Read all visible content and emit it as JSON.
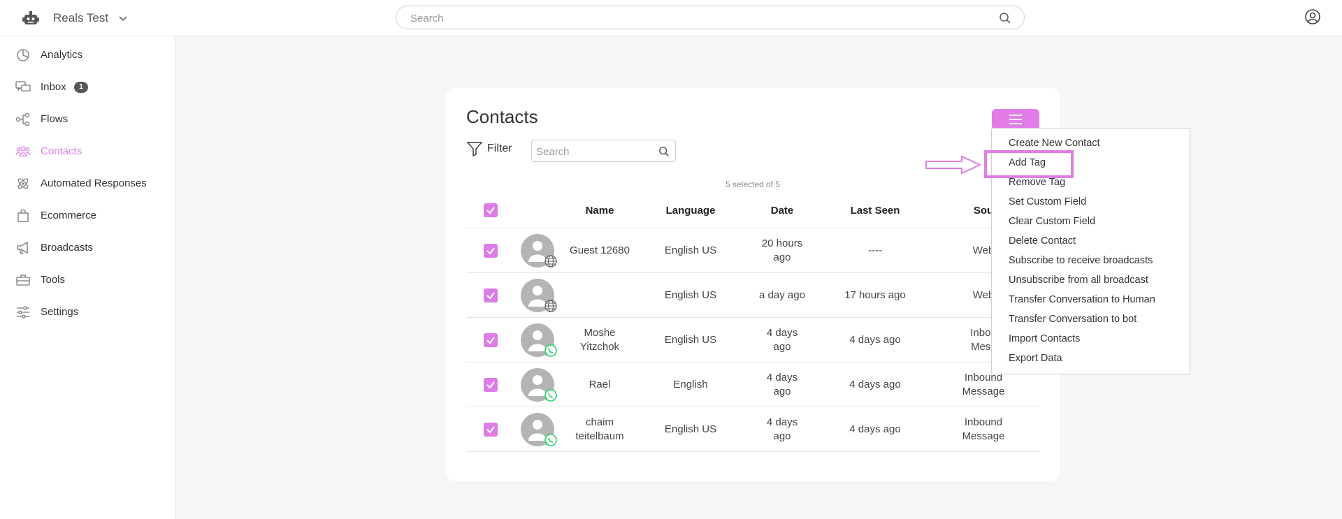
{
  "app": {
    "workspace_name": "Reals Test",
    "search_placeholder": "Search"
  },
  "sidebar": {
    "items": [
      {
        "label": "Analytics",
        "icon": "pie-chart-icon"
      },
      {
        "label": "Inbox",
        "icon": "chat-bubbles-icon",
        "badge": "1"
      },
      {
        "label": "Flows",
        "icon": "flow-nodes-icon"
      },
      {
        "label": "Contacts",
        "icon": "people-icon",
        "active": true
      },
      {
        "label": "Automated Responses",
        "icon": "atom-icon"
      },
      {
        "label": "Ecommerce",
        "icon": "shopping-bag-icon"
      },
      {
        "label": "Broadcasts",
        "icon": "megaphone-icon"
      },
      {
        "label": "Tools",
        "icon": "toolbox-icon"
      },
      {
        "label": "Settings",
        "icon": "sliders-icon"
      }
    ]
  },
  "contacts": {
    "title": "Contacts",
    "filter_label": "Filter",
    "search_placeholder": "Search",
    "selection_note": "5 selected of 5",
    "columns": [
      "Name",
      "Language",
      "Date",
      "Last Seen",
      "Sou"
    ],
    "rows": [
      {
        "name": [
          "Guest 12680"
        ],
        "language": "English US",
        "date": [
          "20 hours",
          "ago"
        ],
        "last_seen": "----",
        "source": [
          "Web"
        ],
        "channel": "web-globe-icon"
      },
      {
        "name": [
          ""
        ],
        "language": "English US",
        "date": [
          "a day ago"
        ],
        "last_seen": "17 hours ago",
        "source": [
          "Web"
        ],
        "channel": "web-globe-icon"
      },
      {
        "name": [
          "Moshe",
          "Yitzchok"
        ],
        "language": "English US",
        "date": [
          "4 days",
          "ago"
        ],
        "last_seen": "4 days ago",
        "source": [
          "Inbou",
          "Mess"
        ],
        "channel": "whatsapp-icon"
      },
      {
        "name": [
          "Rael"
        ],
        "language": "English",
        "date": [
          "4 days",
          "ago"
        ],
        "last_seen": "4 days ago",
        "source": [
          "Inbound",
          "Message"
        ],
        "channel": "whatsapp-icon"
      },
      {
        "name": [
          "chaim",
          "teitelbaum"
        ],
        "language": "English US",
        "date": [
          "4 days",
          "ago"
        ],
        "last_seen": "4 days ago",
        "source": [
          "Inbound",
          "Message"
        ],
        "channel": "whatsapp-icon"
      }
    ]
  },
  "actions_menu": {
    "items": [
      "Create New Contact",
      "Add Tag",
      "Remove Tag",
      "Set Custom Field",
      "Clear Custom Field",
      "Delete Contact",
      "Subscribe to receive broadcasts",
      "Unsubscribe from all broadcast",
      "Transfer Conversation to Human",
      "Transfer Conversation to bot",
      "Import Contacts",
      "Export Data"
    ],
    "highlighted": "Add Tag"
  },
  "colors": {
    "accent": "#e27de8",
    "checkbox": "#dc7de6",
    "badge": "#56575f",
    "whatsapp": "#25d366"
  }
}
